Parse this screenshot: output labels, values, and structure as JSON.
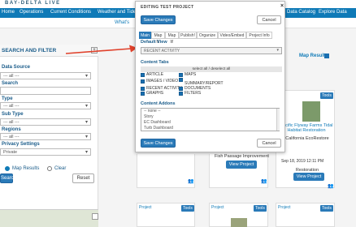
{
  "site": {
    "logo": "BAY-DELTA LIVE",
    "nav": [
      "Home",
      "Operations",
      "Current Conditions",
      "Weather and Tide",
      "Data Catalog",
      "Explore Data"
    ],
    "subnav_partial": "What's"
  },
  "sidebar": {
    "title": "SEARCH AND FILTER",
    "toggle": "+",
    "filters": [
      {
        "label": "Data Source",
        "value": "--- all ---"
      },
      {
        "label": "Search",
        "value": ""
      },
      {
        "label": "Type",
        "value": "--- all ---"
      },
      {
        "label": "Sub Type",
        "value": "--- all ---"
      },
      {
        "label": "Regions",
        "value": "--- all ---"
      },
      {
        "label": "Privacy Settings",
        "value": "Private"
      }
    ],
    "radio_map_results": "Map Results",
    "radio_clear": "Clear",
    "search_button": "Search",
    "reset_button": "Reset"
  },
  "results": {
    "map_results_label": "Map Results",
    "cards": [
      {
        "project": "Project",
        "tools": "Tools"
      },
      {
        "project": "Project",
        "tools": "Tools",
        "title": "Fish Passage Improvement",
        "view": "View Project"
      },
      {
        "project": "Project",
        "tools": "Tools",
        "title_link": "Pacific Flyway Farms Tidal Habitat Restoration",
        "org": "California EcoRestore",
        "date": "Sep 18, 2019 12:11 PM",
        "category": "Restoration",
        "view": "View Project"
      },
      {
        "project": "Project",
        "tools": "Tools"
      },
      {
        "project": "Project",
        "tools": "Tools"
      },
      {
        "project": "Project",
        "tools": "Tools"
      }
    ]
  },
  "modal": {
    "title": "EDITING TEST PROJECT",
    "close": "×",
    "save_top": "Save Changes",
    "cancel_top": "Cancel",
    "tabs": [
      {
        "label": "Main",
        "active": true
      },
      {
        "label": "Map It!",
        "active": false
      },
      {
        "label": "Map It!",
        "active": false
      },
      {
        "label": "Publish!",
        "active": false
      },
      {
        "label": "Organize",
        "active": false
      },
      {
        "label": "Video/Embed",
        "active": false
      },
      {
        "label": "Project Info",
        "active": false
      }
    ],
    "default_view_label": "Default View",
    "default_view_value": "RECENT ACTIVITY",
    "content_tabs_label": "Content Tabs",
    "select_all_bar": "select all / deselect all",
    "checkboxes": [
      {
        "label": "ARTICLE",
        "checked": true
      },
      {
        "label": "MAPS",
        "checked": true
      },
      {
        "label": "IMAGES / VIDEO",
        "checked": true
      },
      {
        "label": "SUMMARY/REPORT",
        "checked": true
      },
      {
        "label": "RECENT ACTIVITY",
        "checked": true
      },
      {
        "label": "DOCUMENTS",
        "checked": true
      },
      {
        "label": "GRAPHS",
        "checked": true
      },
      {
        "label": "FILTERS",
        "checked": true
      }
    ],
    "addons_label": "Content Addons",
    "addons": [
      "-- none --",
      "Story",
      "EC Dashboard",
      "Turb Dashboard"
    ],
    "save_bottom": "Save Changes",
    "cancel_bottom": "Cancel"
  },
  "colors": {
    "nav_blue": "#0f7ab7",
    "button_blue": "#2a7ab8",
    "arrow_red": "#e0402a"
  }
}
